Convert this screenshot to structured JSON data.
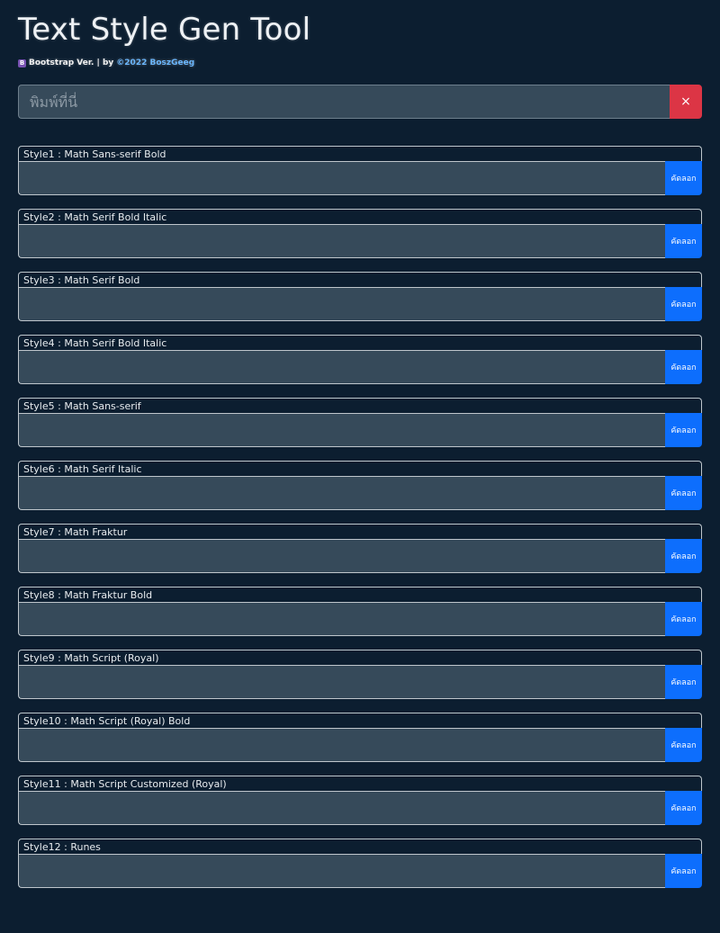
{
  "header": {
    "title": "Text Style Gen Tool",
    "subtitle_badge": "B",
    "subtitle_text": "Bootstrap Ver. | by",
    "subtitle_link": "©2022 BoszGeeg"
  },
  "input": {
    "placeholder": "พิมพ์ที่นี่",
    "value": "",
    "clear_label": "×"
  },
  "styles": [
    {
      "label": "Style1 : Math Sans-serif Bold",
      "value": "",
      "copy_label": "คัดลอก"
    },
    {
      "label": "Style2 : Math Serif Bold Italic",
      "value": "",
      "copy_label": "คัดลอก"
    },
    {
      "label": "Style3 : Math Serif Bold",
      "value": "",
      "copy_label": "คัดลอก"
    },
    {
      "label": "Style4 : Math Serif Bold Italic",
      "value": "",
      "copy_label": "คัดลอก"
    },
    {
      "label": "Style5 : Math Sans-serif",
      "value": "",
      "copy_label": "คัดลอก"
    },
    {
      "label": "Style6 : Math Serif Italic",
      "value": "",
      "copy_label": "คัดลอก"
    },
    {
      "label": "Style7 : Math Fraktur",
      "value": "",
      "copy_label": "คัดลอก"
    },
    {
      "label": "Style8 : Math Fraktur Bold",
      "value": "",
      "copy_label": "คัดลอก"
    },
    {
      "label": "Style9 : Math Script (Royal)",
      "value": "",
      "copy_label": "คัดลอก"
    },
    {
      "label": "Style10 : Math Script (Royal) Bold",
      "value": "",
      "copy_label": "คัดลอก"
    },
    {
      "label": "Style11 : Math Script Customized (Royal)",
      "value": "",
      "copy_label": "คัดลอก"
    },
    {
      "label": "Style12 : Runes",
      "value": "",
      "copy_label": "คัดลอก"
    }
  ],
  "colors": {
    "background": "#0c1e30",
    "input_bg": "#364a5a",
    "clear_button": "#dc3545",
    "copy_button": "#0d6efd",
    "link": "#6ab7ff",
    "bootstrap_badge": "#7952b3"
  }
}
